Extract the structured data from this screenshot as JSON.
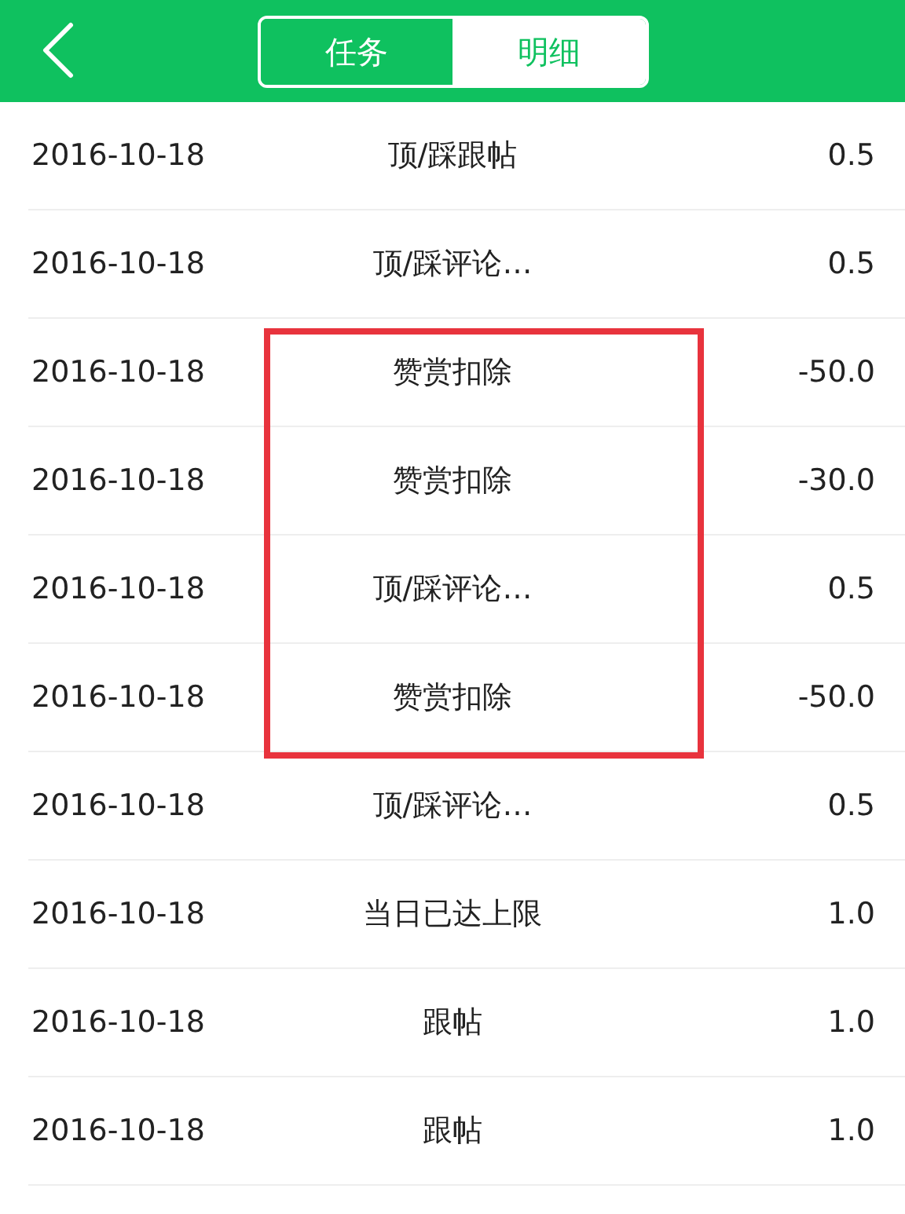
{
  "tabs": [
    {
      "label": "任务",
      "selected": false
    },
    {
      "label": "明细",
      "selected": true
    }
  ],
  "rows": [
    {
      "date": "2016-10-18",
      "item": "顶/踩跟帖",
      "amount": "0.5",
      "highlighted": false
    },
    {
      "date": "2016-10-18",
      "item": "顶/踩评论…",
      "amount": "0.5",
      "highlighted": false
    },
    {
      "date": "2016-10-18",
      "item": "赞赏扣除",
      "amount": "-50.0",
      "highlighted": true
    },
    {
      "date": "2016-10-18",
      "item": "赞赏扣除",
      "amount": "-30.0",
      "highlighted": true
    },
    {
      "date": "2016-10-18",
      "item": "顶/踩评论…",
      "amount": "0.5",
      "highlighted": true
    },
    {
      "date": "2016-10-18",
      "item": "赞赏扣除",
      "amount": "-50.0",
      "highlighted": true
    },
    {
      "date": "2016-10-18",
      "item": "顶/踩评论…",
      "amount": "0.5",
      "highlighted": false
    },
    {
      "date": "2016-10-18",
      "item": "当日已达上限",
      "amount": "1.0",
      "highlighted": false
    },
    {
      "date": "2016-10-18",
      "item": "跟帖",
      "amount": "1.0",
      "highlighted": false
    },
    {
      "date": "2016-10-18",
      "item": "跟帖",
      "amount": "1.0",
      "highlighted": false
    }
  ]
}
